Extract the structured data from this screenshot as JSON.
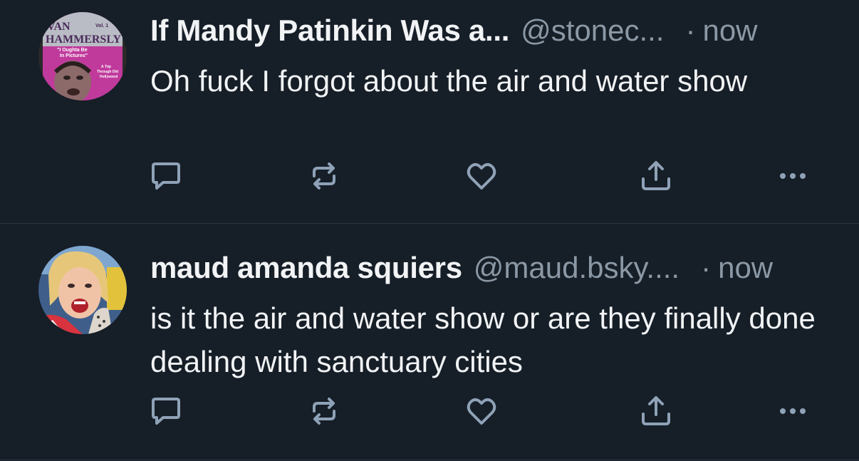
{
  "posts": [
    {
      "display_name": "If Mandy Patinkin Was a...",
      "handle": "@stonec...",
      "separator": "·",
      "time": "now",
      "text": "Oh fuck I forgot about the air and water show",
      "avatar": {
        "type": "book-cover",
        "lines": [
          "VAN",
          "Vol. 1",
          "HAMMERSLY",
          "\"I Oughta Be",
          "In Pictures\"",
          "A Trip",
          "Through Old",
          "Hollywood"
        ],
        "bg_color": "#c03a9c"
      },
      "actions": [
        "reply-icon",
        "repost-icon",
        "like-icon",
        "share-icon",
        "more-icon"
      ]
    },
    {
      "display_name": "maud amanda squiers",
      "handle": "@maud.bsky....",
      "separator": "·",
      "time": "now",
      "text": "is it the air and water show or are they finally done dealing with sanctuary cities",
      "avatar": {
        "type": "photo"
      },
      "actions": [
        "reply-icon",
        "repost-icon",
        "like-icon",
        "share-icon",
        "more-icon"
      ]
    }
  ],
  "colors": {
    "background": "#161e27",
    "text": "#f1f3f5",
    "muted": "#8b98a5",
    "icon": "#8fa2b7",
    "divider": "#2b3642"
  }
}
